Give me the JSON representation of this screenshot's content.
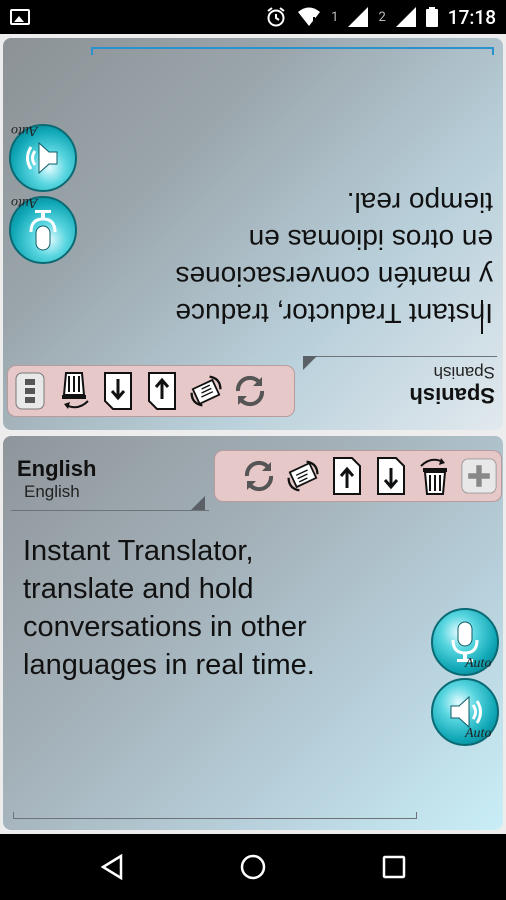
{
  "status_bar": {
    "sim1": "1",
    "sim2": "2",
    "time": "17:18"
  },
  "top_panel": {
    "language_title": "Spanish",
    "language_subtitle": "Spanish",
    "auto_labels": [
      "Auto",
      "Auto"
    ],
    "translation_text": [
      "Instant Traductor, traduce",
      "y  mantén conversaciones",
      "en otros idiomas en",
      "tiempo real."
    ]
  },
  "bottom_panel": {
    "language_title": "English",
    "language_subtitle": "English",
    "auto_labels": [
      "Auto",
      "Auto"
    ],
    "source_text": [
      "Instant Translator,",
      "translate and hold",
      "conversations in other",
      "languages in real time."
    ]
  },
  "icons": {
    "mic": "microphone-icon",
    "speaker": "speaker-icon",
    "refresh": "refresh-icon",
    "swap": "swap-cards-icon",
    "upload": "upload-icon",
    "download": "download-icon",
    "trash": "trash-icon",
    "add": "add-icon",
    "menu": "menu-icon"
  },
  "colors": {
    "accent": "#2a93ce",
    "toolbar_bg": "#e7c8c8",
    "button_teal": "#10a7b6"
  }
}
